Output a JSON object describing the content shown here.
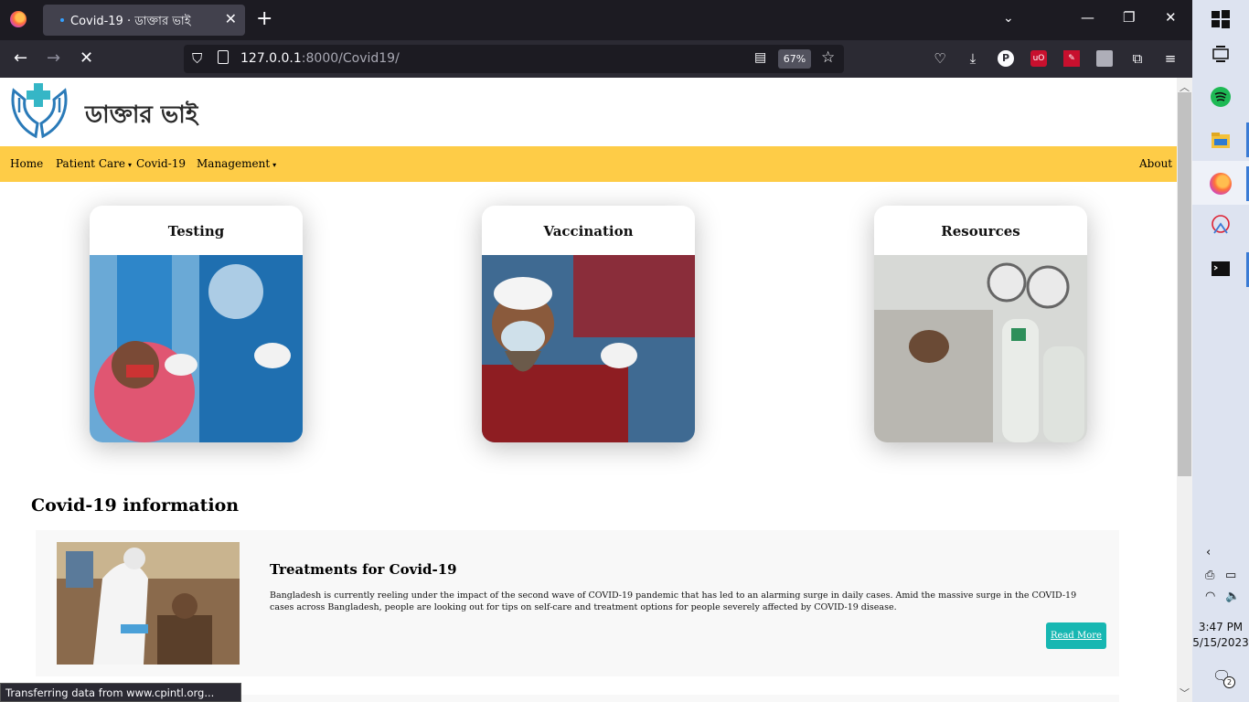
{
  "browser": {
    "tab_title": "Covid-19 · ডাক্তার ভাই",
    "url_host": "127.0.0.1",
    "url_path": ":8000/Covid19/",
    "zoom": "67%"
  },
  "site": {
    "brand": "ডাক্তার ভাই",
    "menu": {
      "home": "Home",
      "patient_care": "Patient Care",
      "covid": "Covid-19",
      "management": "Management",
      "about": "About",
      "caret": "▾"
    },
    "cards": [
      {
        "title": "Testing"
      },
      {
        "title": "Vaccination"
      },
      {
        "title": "Resources"
      }
    ],
    "section_title": "Covid-19 information",
    "article": {
      "title": "Treatments for Covid-19",
      "body": "Bangladesh is currently reeling under the impact of the second wave of COVID-19 pandemic that has led to an alarming surge in daily cases. Amid the massive surge in the COVID-19 cases across Bangladesh, people are looking out for tips on self-care and treatment options for people severely affected by COVID-19 disease.",
      "button": "Read More"
    }
  },
  "status_text": "Transferring data from www.cpintl.org...",
  "taskbar": {
    "time": "3:47 PM",
    "date": "5/15/2023",
    "notifications": "2"
  },
  "colors": {
    "menu_bg": "#fecc47",
    "button_bg": "#17b7b2",
    "logo": "#2a7ab8",
    "logo_cross": "#35b6c6"
  }
}
